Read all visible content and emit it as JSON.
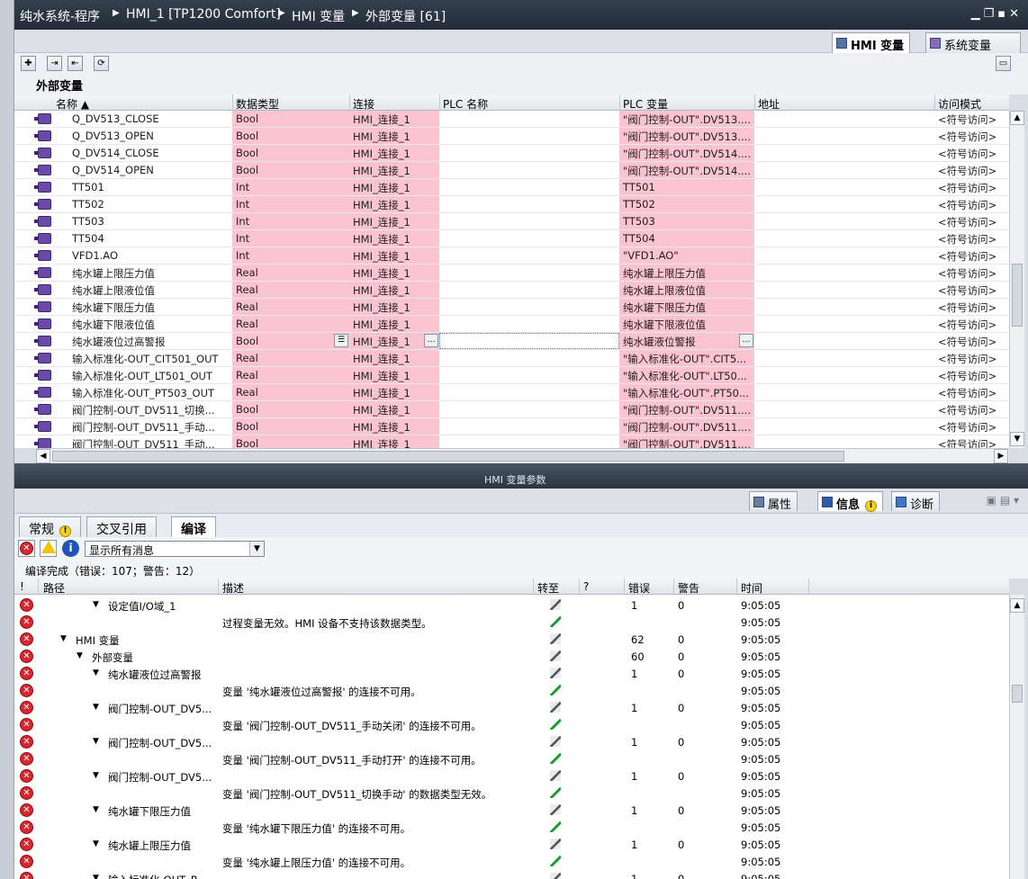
{
  "window": {
    "breadcrumbs": [
      "纯水系统-程序",
      "HMI_1 [TP1200 Comfort]",
      "HMI 变量",
      "外部变量 [61]"
    ],
    "controls": [
      "▁",
      "❐",
      "▪",
      "✕"
    ]
  },
  "top_tabs": [
    {
      "label": "HMI 变量",
      "active": true
    },
    {
      "label": "系统变量",
      "active": false
    }
  ],
  "section_title": "外部变量",
  "table": {
    "columns": [
      "名称 ▲",
      "数据类型",
      "连接",
      "PLC 名称",
      "PLC 变量",
      "地址",
      "访问模式"
    ],
    "rows": [
      [
        "Q_DV513_CLOSE",
        "Bool",
        "HMI_连接_1",
        "",
        "\"阀门控制-OUT\".DV513....",
        "",
        "<符号访问>"
      ],
      [
        "Q_DV513_OPEN",
        "Bool",
        "HMI_连接_1",
        "",
        "\"阀门控制-OUT\".DV513....",
        "",
        "<符号访问>"
      ],
      [
        "Q_DV514_CLOSE",
        "Bool",
        "HMI_连接_1",
        "",
        "\"阀门控制-OUT\".DV514....",
        "",
        "<符号访问>"
      ],
      [
        "Q_DV514_OPEN",
        "Bool",
        "HMI_连接_1",
        "",
        "\"阀门控制-OUT\".DV514....",
        "",
        "<符号访问>"
      ],
      [
        "TT501",
        "Int",
        "HMI_连接_1",
        "",
        "TT501",
        "",
        "<符号访问>"
      ],
      [
        "TT502",
        "Int",
        "HMI_连接_1",
        "",
        "TT502",
        "",
        "<符号访问>"
      ],
      [
        "TT503",
        "Int",
        "HMI_连接_1",
        "",
        "TT503",
        "",
        "<符号访问>"
      ],
      [
        "TT504",
        "Int",
        "HMI_连接_1",
        "",
        "TT504",
        "",
        "<符号访问>"
      ],
      [
        "VFD1.AO",
        "Int",
        "HMI_连接_1",
        "",
        "\"VFD1.AO\"",
        "",
        "<符号访问>"
      ],
      [
        "纯水罐上限压力值",
        "Real",
        "HMI_连接_1",
        "",
        "纯水罐上限压力值",
        "",
        "<符号访问>"
      ],
      [
        "纯水罐上限液位值",
        "Real",
        "HMI_连接_1",
        "",
        "纯水罐上限液位值",
        "",
        "<符号访问>"
      ],
      [
        "纯水罐下限压力值",
        "Real",
        "HMI_连接_1",
        "",
        "纯水罐下限压力值",
        "",
        "<符号访问>"
      ],
      [
        "纯水罐下限液位值",
        "Real",
        "HMI_连接_1",
        "",
        "纯水罐下限液位值",
        "",
        "<符号访问>"
      ],
      [
        "纯水罐液位过高警报",
        "Bool",
        "HMI_连接_1",
        "",
        "纯水罐液位警报",
        "",
        "<符号访问>"
      ],
      [
        "输入标准化-OUT_CIT501_OUT",
        "Real",
        "HMI_连接_1",
        "",
        "\"输入标准化-OUT\".CIT5...",
        "",
        "<符号访问>"
      ],
      [
        "输入标准化-OUT_LT501_OUT",
        "Real",
        "HMI_连接_1",
        "",
        "\"输入标准化-OUT\".LT50...",
        "",
        "<符号访问>"
      ],
      [
        "输入标准化-OUT_PT503_OUT",
        "Real",
        "HMI_连接_1",
        "",
        "\"输入标准化-OUT\".PT50...",
        "",
        "<符号访问>"
      ],
      [
        "阀门控制-OUT_DV511_切换...",
        "Bool",
        "HMI_连接_1",
        "",
        "\"阀门控制-OUT\".DV511....",
        "",
        "<符号访问>"
      ],
      [
        "阀门控制-OUT_DV511_手动...",
        "Bool",
        "HMI_连接_1",
        "",
        "\"阀门控制-OUT\".DV511....",
        "",
        "<符号访问>"
      ],
      [
        "阀门控制-OUT_DV511_手动...",
        "Bool",
        "HMI_连接_1",
        "",
        "\"阀门控制-OUT\".DV511....",
        "",
        "<符号访问>"
      ]
    ],
    "selected_row": 13
  },
  "splitter_label": "HMI 变量参数",
  "inspector_tabs": [
    {
      "label": "属性",
      "active": false
    },
    {
      "label": "信息",
      "active": true
    },
    {
      "label": "诊断",
      "active": false
    }
  ],
  "sub_tabs": [
    {
      "label": "常规",
      "active": false
    },
    {
      "label": "交叉引用",
      "active": false
    },
    {
      "label": "编译",
      "active": true
    }
  ],
  "filter": {
    "value": "显示所有消息"
  },
  "summary": "编译完成（错误：107；警告：12）",
  "messages": {
    "columns": [
      "!",
      "路径",
      "描述",
      "转至",
      "?",
      "错误",
      "警告",
      "时间"
    ],
    "rows": [
      {
        "indent": 3,
        "expand": true,
        "path": "设定值I/O域_1",
        "desc": "",
        "goto": "gray",
        "errors": "1",
        "warnings": "0",
        "time": "9:05:05"
      },
      {
        "indent": 0,
        "expand": false,
        "path": "",
        "desc": "过程变量无效。HMI 设备不支持该数据类型。",
        "goto": "green",
        "errors": "",
        "warnings": "",
        "time": "9:05:05"
      },
      {
        "indent": 1,
        "expand": true,
        "path": "HMI 变量",
        "desc": "",
        "goto": "gray",
        "errors": "62",
        "warnings": "0",
        "time": "9:05:05"
      },
      {
        "indent": 2,
        "expand": true,
        "path": "外部变量",
        "desc": "",
        "goto": "gray",
        "errors": "60",
        "warnings": "0",
        "time": "9:05:05"
      },
      {
        "indent": 3,
        "expand": true,
        "path": "纯水罐液位过高警报",
        "desc": "",
        "goto": "gray",
        "errors": "1",
        "warnings": "0",
        "time": "9:05:05"
      },
      {
        "indent": 0,
        "expand": false,
        "path": "",
        "desc": "变量 '纯水罐液位过高警报' 的连接不可用。",
        "goto": "green",
        "errors": "",
        "warnings": "",
        "time": "9:05:05"
      },
      {
        "indent": 3,
        "expand": true,
        "path": "阀门控制-OUT_DV5...",
        "desc": "",
        "goto": "gray",
        "errors": "1",
        "warnings": "0",
        "time": "9:05:05"
      },
      {
        "indent": 0,
        "expand": false,
        "path": "",
        "desc": "变量 '阀门控制-OUT_DV511_手动关闭' 的连接不可用。",
        "goto": "green",
        "errors": "",
        "warnings": "",
        "time": "9:05:05"
      },
      {
        "indent": 3,
        "expand": true,
        "path": "阀门控制-OUT_DV5...",
        "desc": "",
        "goto": "gray",
        "errors": "1",
        "warnings": "0",
        "time": "9:05:05"
      },
      {
        "indent": 0,
        "expand": false,
        "path": "",
        "desc": "变量 '阀门控制-OUT_DV511_手动打开' 的连接不可用。",
        "goto": "green",
        "errors": "",
        "warnings": "",
        "time": "9:05:05"
      },
      {
        "indent": 3,
        "expand": true,
        "path": "阀门控制-OUT_DV5...",
        "desc": "",
        "goto": "gray",
        "errors": "1",
        "warnings": "0",
        "time": "9:05:05"
      },
      {
        "indent": 0,
        "expand": false,
        "path": "",
        "desc": "变量 '阀门控制-OUT_DV511_切换手动' 的数据类型无效。",
        "goto": "green",
        "errors": "",
        "warnings": "",
        "time": "9:05:05"
      },
      {
        "indent": 3,
        "expand": true,
        "path": "纯水罐下限压力值",
        "desc": "",
        "goto": "gray",
        "errors": "1",
        "warnings": "0",
        "time": "9:05:05"
      },
      {
        "indent": 0,
        "expand": false,
        "path": "",
        "desc": "变量 '纯水罐下限压力值' 的连接不可用。",
        "goto": "green",
        "errors": "",
        "warnings": "",
        "time": "9:05:05"
      },
      {
        "indent": 3,
        "expand": true,
        "path": "纯水罐上限压力值",
        "desc": "",
        "goto": "gray",
        "errors": "1",
        "warnings": "0",
        "time": "9:05:05"
      },
      {
        "indent": 0,
        "expand": false,
        "path": "",
        "desc": "变量 '纯水罐上限压力值' 的连接不可用。",
        "goto": "green",
        "errors": "",
        "warnings": "",
        "time": "9:05:05"
      },
      {
        "indent": 3,
        "expand": true,
        "path": "输入标准化-OUT_P...",
        "desc": "",
        "goto": "gray",
        "errors": "1",
        "warnings": "0",
        "time": "9:05:05"
      }
    ]
  },
  "colors": {
    "title_bar": "#2b3542",
    "pink_cell": "#fbc4d0",
    "error_red": "#d7262e",
    "goto_green": "#1c9a2f"
  },
  "icons": [
    "add-variable-icon",
    "export-icon",
    "import-icon",
    "sync-icon",
    "panel-layout-icon",
    "error-filter-icon",
    "warning-filter-icon",
    "info-filter-icon",
    "dropdown-arrow-icon"
  ]
}
